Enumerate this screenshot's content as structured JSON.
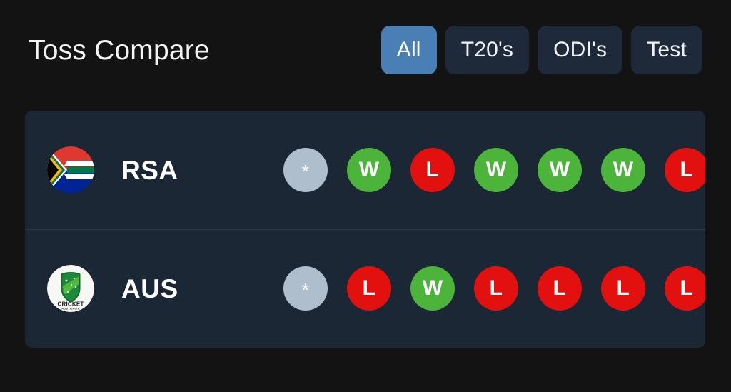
{
  "header": {
    "title": "Toss Compare",
    "filters": [
      {
        "label": "All",
        "active": true
      },
      {
        "label": "T20's",
        "active": false
      },
      {
        "label": "ODI's",
        "active": false
      },
      {
        "label": "Test",
        "active": false
      }
    ]
  },
  "colors": {
    "page_background": "#131314",
    "card_background": "#1c2735",
    "filter_active": "#4a7fb5",
    "filter_inactive": "#1e2a3a",
    "win": "#4cb43a",
    "loss": "#e31010",
    "neutral": "#aebecd",
    "divider": "#2b3848",
    "text": "#ffffff"
  },
  "rows": [
    {
      "team_code": "RSA",
      "logo": "south-africa-flag-icon",
      "results": [
        {
          "label": "*",
          "outcome": "none"
        },
        {
          "label": "W",
          "outcome": "win"
        },
        {
          "label": "L",
          "outcome": "loss"
        },
        {
          "label": "W",
          "outcome": "win"
        },
        {
          "label": "W",
          "outcome": "win"
        },
        {
          "label": "W",
          "outcome": "win"
        },
        {
          "label": "L",
          "outcome": "loss"
        }
      ]
    },
    {
      "team_code": "AUS",
      "logo": "cricket-australia-logo-icon",
      "results": [
        {
          "label": "*",
          "outcome": "none"
        },
        {
          "label": "L",
          "outcome": "loss"
        },
        {
          "label": "W",
          "outcome": "win"
        },
        {
          "label": "L",
          "outcome": "loss"
        },
        {
          "label": "L",
          "outcome": "loss"
        },
        {
          "label": "L",
          "outcome": "loss"
        },
        {
          "label": "L",
          "outcome": "loss"
        }
      ]
    }
  ]
}
